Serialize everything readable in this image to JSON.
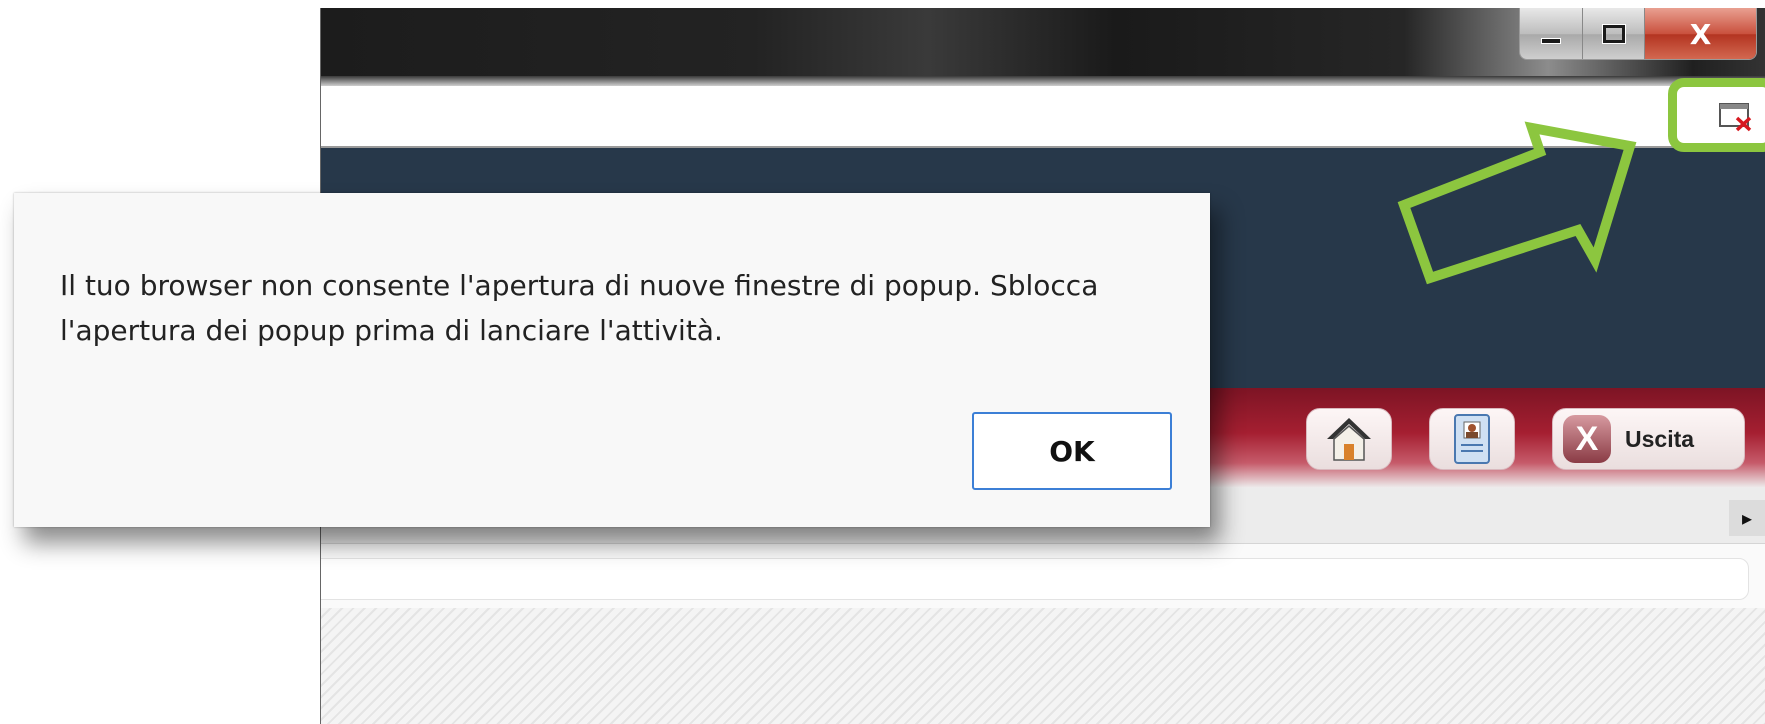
{
  "window": {
    "controls": {
      "minimize": "minimize",
      "maximize": "maximize",
      "close": "X"
    }
  },
  "address_bar": {
    "popup_blocked_icon": "popup-blocked-icon"
  },
  "toolbar": {
    "buttons": [
      {
        "name": "home",
        "icon": "home-icon"
      },
      {
        "name": "profile",
        "icon": "profile-card-icon"
      },
      {
        "name": "exit",
        "icon": "exit-x-icon",
        "icon_glyph": "X",
        "label": "Uscita"
      }
    ]
  },
  "subbar": {
    "expand_icon": "expand-arrow-icon"
  },
  "annotation": {
    "color": "#8cc63f",
    "shape": "arrow pointing to popup-blocked icon"
  },
  "dialog": {
    "message": "Il tuo browser non consente l'apertura di nuove finestre di popup. Sblocca l'apertura dei popup prima di lanciare l'attività.",
    "ok_label": "OK"
  },
  "colors": {
    "header": "#27384a",
    "toolbar": "#a51f31",
    "accent_highlight": "#8cc63f",
    "ok_border": "#3c7fd6"
  }
}
